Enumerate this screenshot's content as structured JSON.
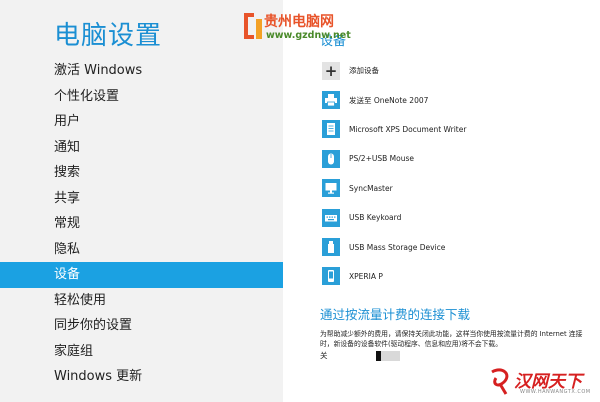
{
  "page": {
    "title": "电脑设置"
  },
  "nav": {
    "items": [
      {
        "label": "激活 Windows",
        "selected": false
      },
      {
        "label": "个性化设置",
        "selected": false
      },
      {
        "label": "用户",
        "selected": false
      },
      {
        "label": "通知",
        "selected": false
      },
      {
        "label": "搜索",
        "selected": false
      },
      {
        "label": "共享",
        "selected": false
      },
      {
        "label": "常规",
        "selected": false
      },
      {
        "label": "隐私",
        "selected": false
      },
      {
        "label": "设备",
        "selected": true
      },
      {
        "label": "轻松使用",
        "selected": false
      },
      {
        "label": "同步你的设置",
        "selected": false
      },
      {
        "label": "家庭组",
        "selected": false
      },
      {
        "label": "Windows 更新",
        "selected": false
      }
    ]
  },
  "devices": {
    "section_title": "设备",
    "items": [
      {
        "label": "添加设备",
        "icon": "plus-icon"
      },
      {
        "label": "发送至 OneNote 2007",
        "icon": "printer-icon"
      },
      {
        "label": "Microsoft XPS Document Writer",
        "icon": "document-icon"
      },
      {
        "label": "PS/2+USB Mouse",
        "icon": "mouse-icon"
      },
      {
        "label": "SyncMaster",
        "icon": "monitor-icon"
      },
      {
        "label": "USB Keykoard",
        "icon": "keyboard-icon"
      },
      {
        "label": "USB Mass Storage Device",
        "icon": "usb-drive-icon"
      },
      {
        "label": "XPERIA P",
        "icon": "phone-icon"
      }
    ]
  },
  "metered": {
    "title": "通过按流量计费的连接下载",
    "description": "为帮助减少额外的费用，请保持关闭此功能，这样当你使用按流量计费的 Internet 连接时，新设备的设备软件(驱动程序、信息和应用)将不会下载。",
    "toggle_label": "关",
    "toggle_on": false
  },
  "watermarks": {
    "top_name": "贵州电脑网",
    "top_url": "www.gzdnw.net",
    "bottom_text": "汉网天下",
    "bottom_url": "WWW.HANWANGTX.COM"
  },
  "colors": {
    "accent": "#1ba1e2",
    "title": "#1b8fd3",
    "left_bg": "#f2f2f2"
  }
}
